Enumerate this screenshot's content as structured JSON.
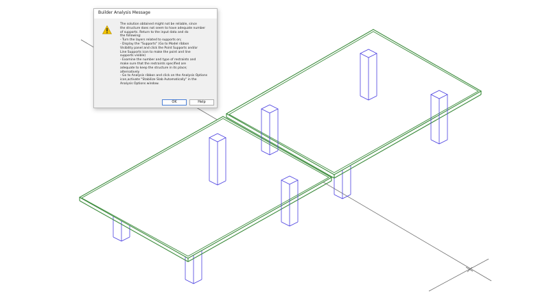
{
  "dialog": {
    "title": "Builder Analysis Message",
    "icon": "warning-icon",
    "message_lines": [
      "The solution obtained might not be reliable, since",
      "the structure does not seem to have adequate number",
      "of supports. Return to the input data and do",
      "the following:",
      "- Turn the layers related to supports on;",
      "- Display the \"Supports\" (Go to Model ribbon",
      "Visibility panel and click the Point Supports and/or",
      "Line Supports icon to make the point and line",
      "supports visible)",
      "- Examine the number and type of restraints and",
      "make sure that the restraints specified are",
      "adequate to keep the structure in its place;",
      "alternatively",
      "- Go to Analysis ribbon and click on the Analysis Options",
      "icon,activate \"Stabilize Slab Automatically\" in the",
      "Analysis Options window."
    ],
    "ok_label": "OK",
    "help_label": "Help"
  },
  "colors": {
    "slab_edge": "#3a8a3a",
    "column": "#4a3fe0",
    "axis": "#6b6b6b",
    "warning": "#f2c200"
  }
}
